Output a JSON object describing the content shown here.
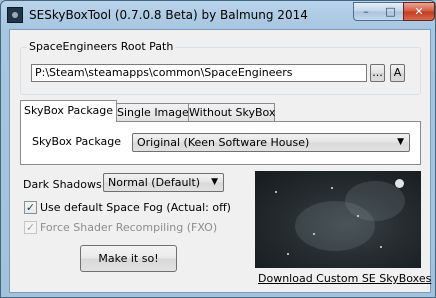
{
  "window": {
    "title": "SESkyBoxTool (0.7.0.8 Beta) by Balmung 2014",
    "minimize_glyph": "–",
    "maximize_glyph": "□",
    "close_glyph": "✕"
  },
  "root_path": {
    "group_label": "SpaceEngineers Root Path",
    "value": "P:\\Steam\\steamapps\\common\\SpaceEngineers",
    "browse_label": "...",
    "auto_label": "A"
  },
  "tabs": [
    {
      "label": "SkyBox Package",
      "active": true
    },
    {
      "label": "Single Image",
      "active": false
    },
    {
      "label": "Without SkyBox",
      "active": false
    }
  ],
  "skybox_tab": {
    "package_label": "SkyBox Package",
    "package_value": "Original (Keen Software House)"
  },
  "options": {
    "dark_shadows_label": "Dark Shadows",
    "dark_shadows_value": "Normal (Default)",
    "space_fog_label": "Use default Space Fog (Actual: off)",
    "space_fog_checked": true,
    "force_shader_label": "Force Shader Recompiling (FXO)",
    "force_shader_checked": true,
    "force_shader_enabled": false
  },
  "actions": {
    "make_label": "Make it so!",
    "download_link": "Download Custom SE SkyBoxes"
  },
  "colors": {
    "titlebar": "#b9d3ea",
    "client_bg": "#f0f0f0",
    "close_button": "#c8442a"
  }
}
